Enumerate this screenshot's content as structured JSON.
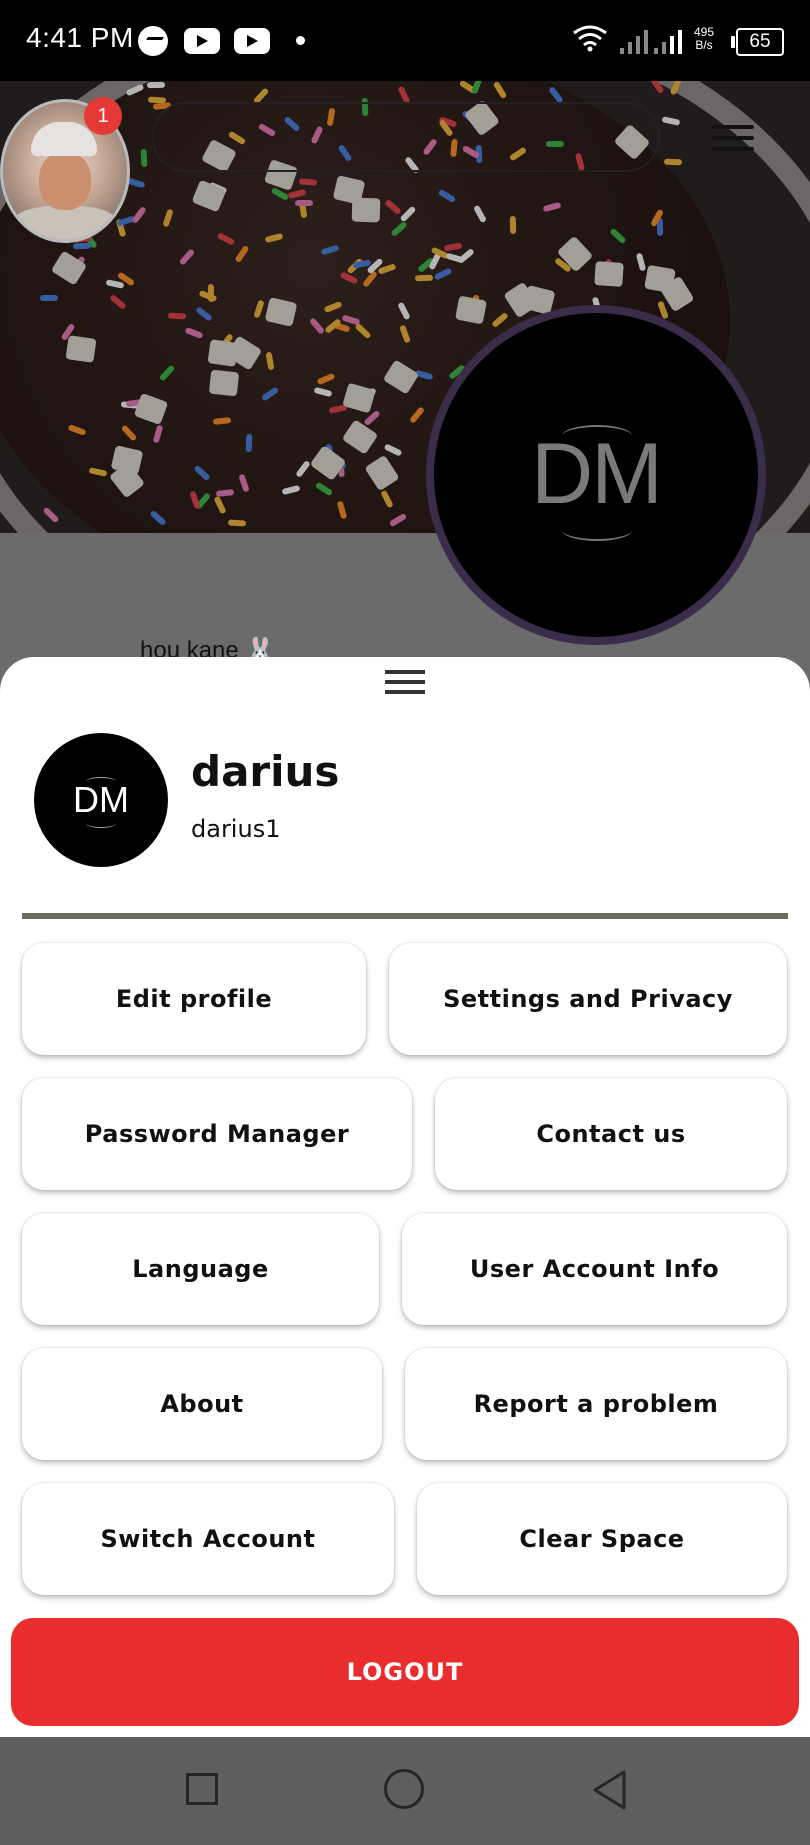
{
  "status_bar": {
    "time": "4:41 PM",
    "net_speed_value": "495",
    "net_speed_unit": "B/s",
    "battery": "65",
    "icons": [
      "messenger-icon",
      "youtube-icon",
      "youtube-icon",
      "dot-icon",
      "wifi-icon",
      "signal-icon",
      "battery-icon"
    ]
  },
  "profile_background": {
    "notification_count": "1",
    "avatar_initials": "DM",
    "bio": "hou kane 🐰"
  },
  "sheet": {
    "avatar_initials": "DM",
    "display_name": "darius",
    "username": "darius1",
    "options": [
      {
        "label": "Edit profile"
      },
      {
        "label": "Settings and Privacy"
      },
      {
        "label": "Password Manager"
      },
      {
        "label": "Contact us"
      },
      {
        "label": "Language"
      },
      {
        "label": "User Account Info"
      },
      {
        "label": "About"
      },
      {
        "label": "Report a problem"
      },
      {
        "label": "Switch Account"
      },
      {
        "label": "Clear Space"
      }
    ],
    "logout_label": "LOGOUT"
  },
  "colors": {
    "logout": "#e92c2c",
    "badge": "#e53935",
    "divider": "#6b6c5e",
    "avatar_ring": "#3a2d4a"
  }
}
